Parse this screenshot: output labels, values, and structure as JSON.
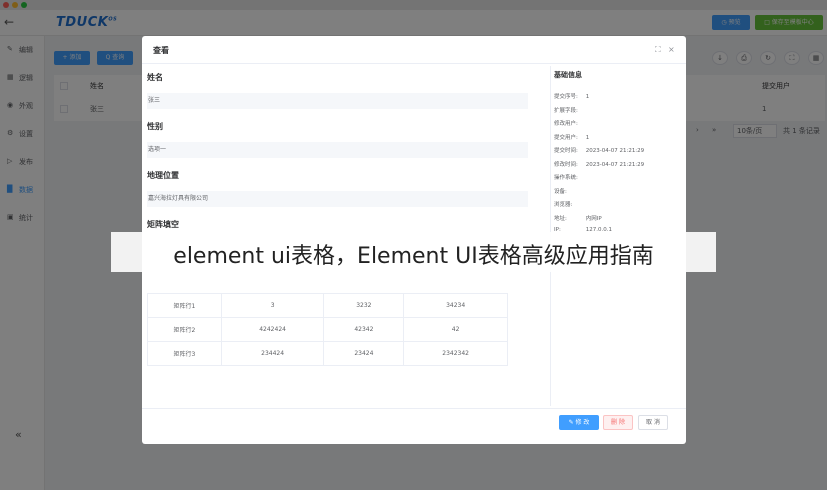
{
  "header": {
    "logo_text": "TDUCK",
    "logo_sup": "OS",
    "preview_label": "预览",
    "save_label": "保存至模板中心"
  },
  "sidebar": {
    "items": [
      {
        "label": "编辑",
        "icon": "edit-icon"
      },
      {
        "label": "逻辑",
        "icon": "grid-icon"
      },
      {
        "label": "外观",
        "icon": "eye-icon"
      },
      {
        "label": "设置",
        "icon": "gear-icon"
      },
      {
        "label": "发布",
        "icon": "play-icon"
      },
      {
        "label": "数据",
        "icon": "bar-chart-icon"
      },
      {
        "label": "统计",
        "icon": "chat-icon"
      }
    ],
    "active_index": 5
  },
  "toolbar": {
    "add_label": "+ 添加",
    "query_label": "Q 查询"
  },
  "bg_table": {
    "headers": [
      "姓名",
      "提交用户"
    ],
    "row": [
      "张三",
      "1"
    ],
    "pager_size": "10条/页",
    "pager_total": "共 1 条记录"
  },
  "dialog": {
    "title": "查看",
    "fields": [
      {
        "label": "姓名",
        "value": "张三"
      },
      {
        "label": "性别",
        "value": "选项一"
      },
      {
        "label": "地理位置",
        "value": "嘉兴海拉灯具有限公司"
      }
    ],
    "matrix_label": "矩阵填空",
    "matrix_rows": [
      [
        "矩阵行1",
        "3",
        "3232",
        "34234"
      ],
      [
        "矩阵行2",
        "4242424",
        "42342",
        "42"
      ],
      [
        "矩阵行3",
        "234424",
        "23424",
        "2342342"
      ]
    ],
    "info": {
      "title": "基础信息",
      "rows": [
        {
          "key": "提交序号:",
          "value": "1"
        },
        {
          "key": "扩展字段:",
          "value": ""
        },
        {
          "key": "修改用户:",
          "value": ""
        },
        {
          "key": "提交用户:",
          "value": "1"
        },
        {
          "key": "提交时间:",
          "value": "2023-04-07 21:21:29"
        },
        {
          "key": "修改时间:",
          "value": "2023-04-07 21:21:29"
        },
        {
          "key": "操作系统:",
          "value": ""
        },
        {
          "key": "设备:",
          "value": ""
        },
        {
          "key": "浏览器:",
          "value": ""
        },
        {
          "key": "地址:",
          "value": "内网IP"
        },
        {
          "key": "IP:",
          "value": "127.0.0.1"
        }
      ]
    },
    "edit_label": "修 改",
    "delete_label": "删 除",
    "cancel_label": "取 消"
  },
  "banner": {
    "text": "element ui表格，Element UI表格高级应用指南"
  },
  "colors": {
    "primary": "#409eff",
    "success": "#67c23a",
    "danger": "#f56c6c"
  }
}
